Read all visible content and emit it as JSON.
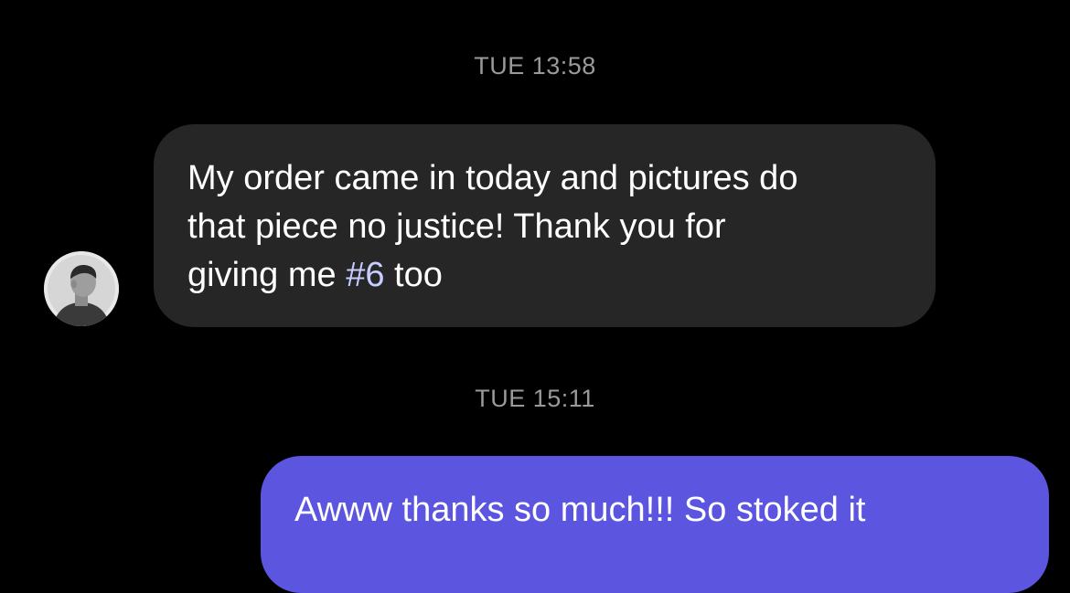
{
  "thread": {
    "timestamp_1": "TUE 13:58",
    "incoming": {
      "line1": "My order came in today and pictures do",
      "line2": "that piece no justice! Thank you for",
      "line3_before": "giving me ",
      "hashtag": "#6",
      "line3_after": " too"
    },
    "timestamp_2": "TUE 15:11",
    "outgoing": {
      "text": "Awww thanks so much!!! So stoked it"
    }
  },
  "colors": {
    "background": "#000000",
    "incoming_bubble": "#262626",
    "outgoing_bubble": "#5b55e0",
    "timestamp": "#9a9a9a",
    "hashtag": "#c7cdff"
  }
}
